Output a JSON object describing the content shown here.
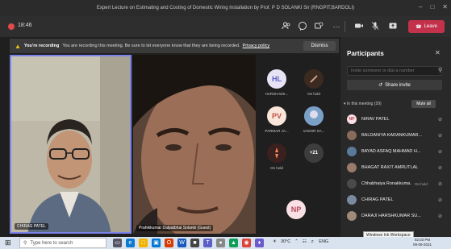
{
  "window": {
    "title": "Expert Lecture on Estimating and Costing of Domestic Wiring Installation by Prof. P D SOLANKI Sir (RNGPIT,BARDOLI)"
  },
  "toolbar": {
    "timer": "18:46",
    "leave_label": "Leave",
    "icons": [
      "people-icon",
      "chat-icon",
      "reactions-icon",
      "more-icon",
      "camera-icon",
      "mic-icon",
      "share-icon",
      "phone-icon"
    ]
  },
  "banner": {
    "bold": "You're recording",
    "message": "You are recording this meeting. Be sure to let everyone know that they are being recorded.",
    "link": "Privacy policy",
    "dismiss": "Dismiss"
  },
  "stage": {
    "tile_a_name": "CHIRAG PATEL",
    "tile_b_name": "Prahikkumar Dalpatbhai Solanki (Guest)",
    "grid": [
      {
        "initials": "HL",
        "label": "HARSHADK...",
        "color": "#e7e3f4",
        "text_color": "#5b5fc7"
      },
      {
        "initials": "",
        "label": "On hold",
        "color": "#3a2a1f",
        "text_color": "#fff"
      },
      {
        "initials": "PV",
        "label": "PARMAR JA...",
        "color": "#f9e5da",
        "text_color": "#c2564c"
      },
      {
        "initials": "",
        "label": "VADOR SA...",
        "color": "#6b8fb5",
        "text_color": "#fff"
      },
      {
        "initials": "",
        "label": "On hold",
        "color": "#3b2020",
        "text_color": "#fff"
      },
      {
        "initials": "+21",
        "label": "",
        "color": "#3d3d3d",
        "text_color": "#fff"
      },
      {
        "initials": "NP",
        "label": "",
        "color": "#f9e0e4",
        "text_color": "#b5465a"
      }
    ]
  },
  "panel": {
    "title": "Participants",
    "invite_placeholder": "Invite someone or dial a number",
    "share_invite": "Share invite",
    "section": "In this meeting (29)",
    "mute_all": "Mute all",
    "participants": [
      {
        "name": "NIRAV PATEL",
        "initials": "NP",
        "color": "#f9e0e4",
        "text_color": "#b5465a",
        "status": ""
      },
      {
        "name": "BALDANIYA KARANKUMAR...",
        "initials": "",
        "color": "#8a6a5a",
        "text_color": "#fff",
        "status": ""
      },
      {
        "name": "BAYAD ASFAQ MAHMAD H...",
        "initials": "",
        "color": "#5a7a9a",
        "text_color": "#fff",
        "status": ""
      },
      {
        "name": "BHAGAT RAXIT AMRUTLAL",
        "initials": "",
        "color": "#9a7a6a",
        "text_color": "#fff",
        "status": ""
      },
      {
        "name": "Chhabhaiya Ronakkuma...",
        "initials": "",
        "color": "#4a4a4a",
        "text_color": "#fff",
        "status": "On hold"
      },
      {
        "name": "CHIRAG PATEL",
        "initials": "",
        "color": "#7a8aa0",
        "text_color": "#fff",
        "status": ""
      },
      {
        "name": "DARAJI HARSHKUMAR SU...",
        "initials": "",
        "color": "#a08a7a",
        "text_color": "#fff",
        "status": ""
      }
    ],
    "tooltip": "Windows Ink Workspace"
  },
  "taskbar": {
    "search_placeholder": "Type here to search",
    "temperature": "30°C",
    "language": "ENG",
    "time": "02:03 PM",
    "date": "09-09-2021"
  }
}
